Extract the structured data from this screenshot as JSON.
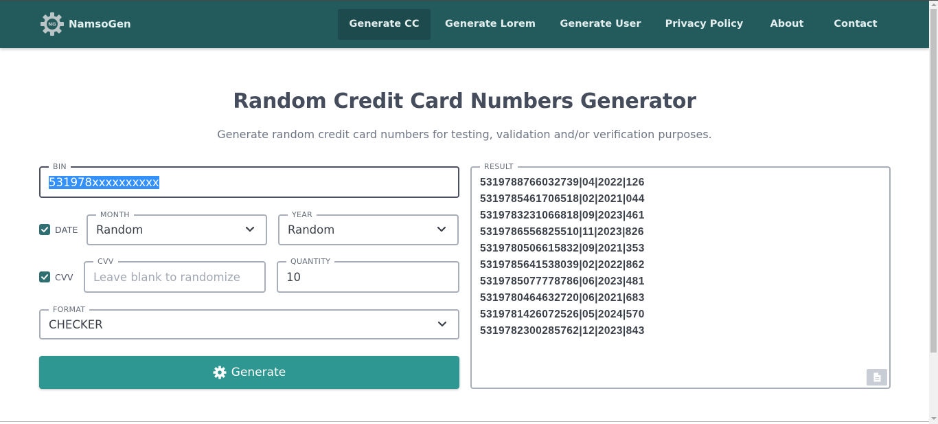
{
  "nav": {
    "brand": "NamsoGen",
    "logo_badge": "NG",
    "items": [
      {
        "label": "Generate CC",
        "active": true
      },
      {
        "label": "Generate Lorem",
        "active": false
      },
      {
        "label": "Generate User",
        "active": false
      },
      {
        "label": "Privacy Policy",
        "active": false
      },
      {
        "label": "About",
        "active": false
      },
      {
        "label": "Contact",
        "active": false
      }
    ]
  },
  "page": {
    "title": "Random Credit Card Numbers Generator",
    "subtitle": "Generate random credit card numbers for testing, validation and/or verification purposes."
  },
  "form": {
    "bin": {
      "label": "BIN",
      "value": "531978xxxxxxxxxx"
    },
    "date": {
      "label": "DATE",
      "checked": true
    },
    "month": {
      "label": "MONTH",
      "value": "Random"
    },
    "year": {
      "label": "YEAR",
      "value": "Random"
    },
    "cvv_check": {
      "label": "CVV",
      "checked": true
    },
    "cvv": {
      "label": "CVV",
      "placeholder": "Leave blank to randomize",
      "value": ""
    },
    "quantity": {
      "label": "QUANTITY",
      "value": "10"
    },
    "format": {
      "label": "FORMAT",
      "value": "CHECKER"
    },
    "generate_label": "Generate"
  },
  "result": {
    "label": "RESULT",
    "lines": [
      "5319788766032739|04|2022|126",
      "5319785461706518|02|2021|044",
      "5319783231066818|09|2023|461",
      "5319786556825510|11|2023|826",
      "5319780506615832|09|2021|353",
      "5319785641538039|02|2022|862",
      "5319785077778786|06|2023|481",
      "5319780464632720|06|2021|683",
      "5319781426072526|05|2024|570",
      "5319782300285762|12|2023|843"
    ]
  },
  "colors": {
    "navbar": "#235a5c",
    "active_nav": "#1d4a4c",
    "button": "#2e9791",
    "checkbox": "#2f6f71",
    "selection": "#3390ff"
  },
  "icons": {
    "logo": "gear-logo-icon",
    "generate": "gear-icon",
    "copy": "document-icon",
    "select_arrow": "chevron-down-icon",
    "checkbox": "checkmark-icon"
  }
}
